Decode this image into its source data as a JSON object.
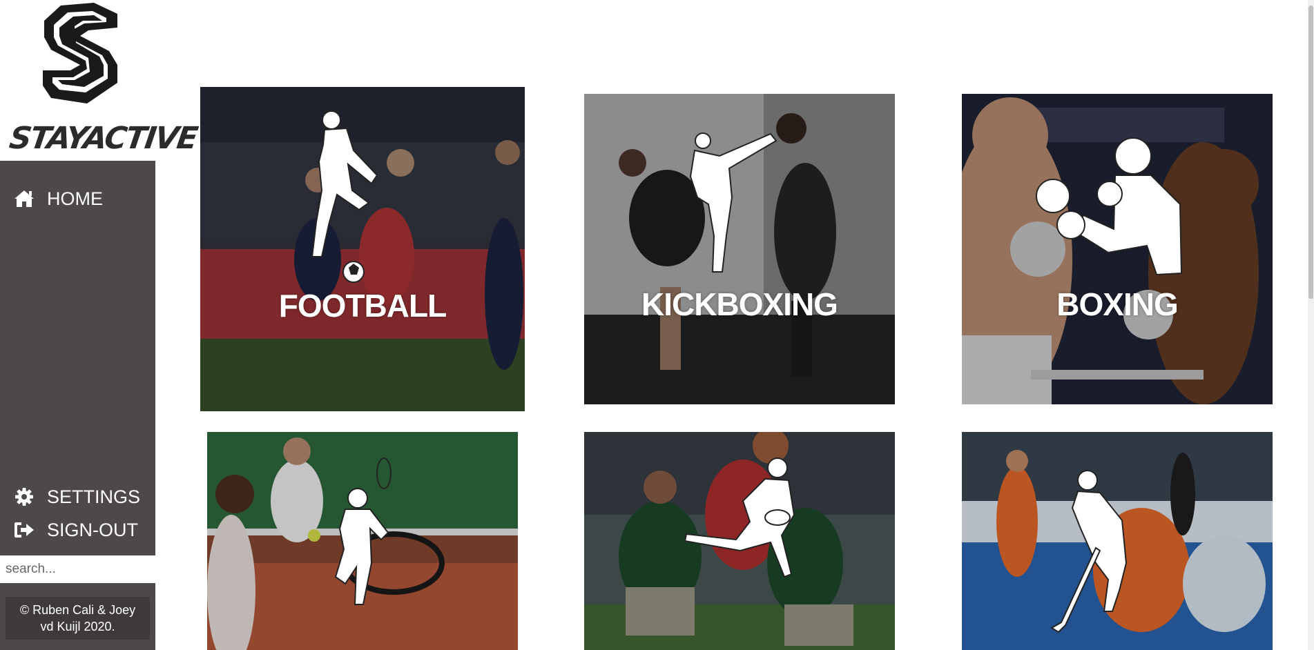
{
  "brand": {
    "name": "STAYACTIVE"
  },
  "nav": {
    "home": {
      "label": "HOME",
      "icon": "home-icon"
    },
    "settings": {
      "label": "SETTINGS",
      "icon": "gear-icon"
    },
    "signout": {
      "label": "SIGN-OUT",
      "icon": "sign-out-icon"
    }
  },
  "search": {
    "placeholder": "search..."
  },
  "footer": {
    "line1": "© Ruben Cali & Joey",
    "line2": "vd Kuijl 2020."
  },
  "sports": [
    {
      "label": "FOOTBALL"
    },
    {
      "label": "KICKBOXING"
    },
    {
      "label": "BOXING"
    },
    {
      "label": ""
    },
    {
      "label": ""
    },
    {
      "label": ""
    }
  ],
  "colors": {
    "sidebar": "#4d4849",
    "footer_box": "#3e3a3b",
    "label": "#ffffff"
  }
}
